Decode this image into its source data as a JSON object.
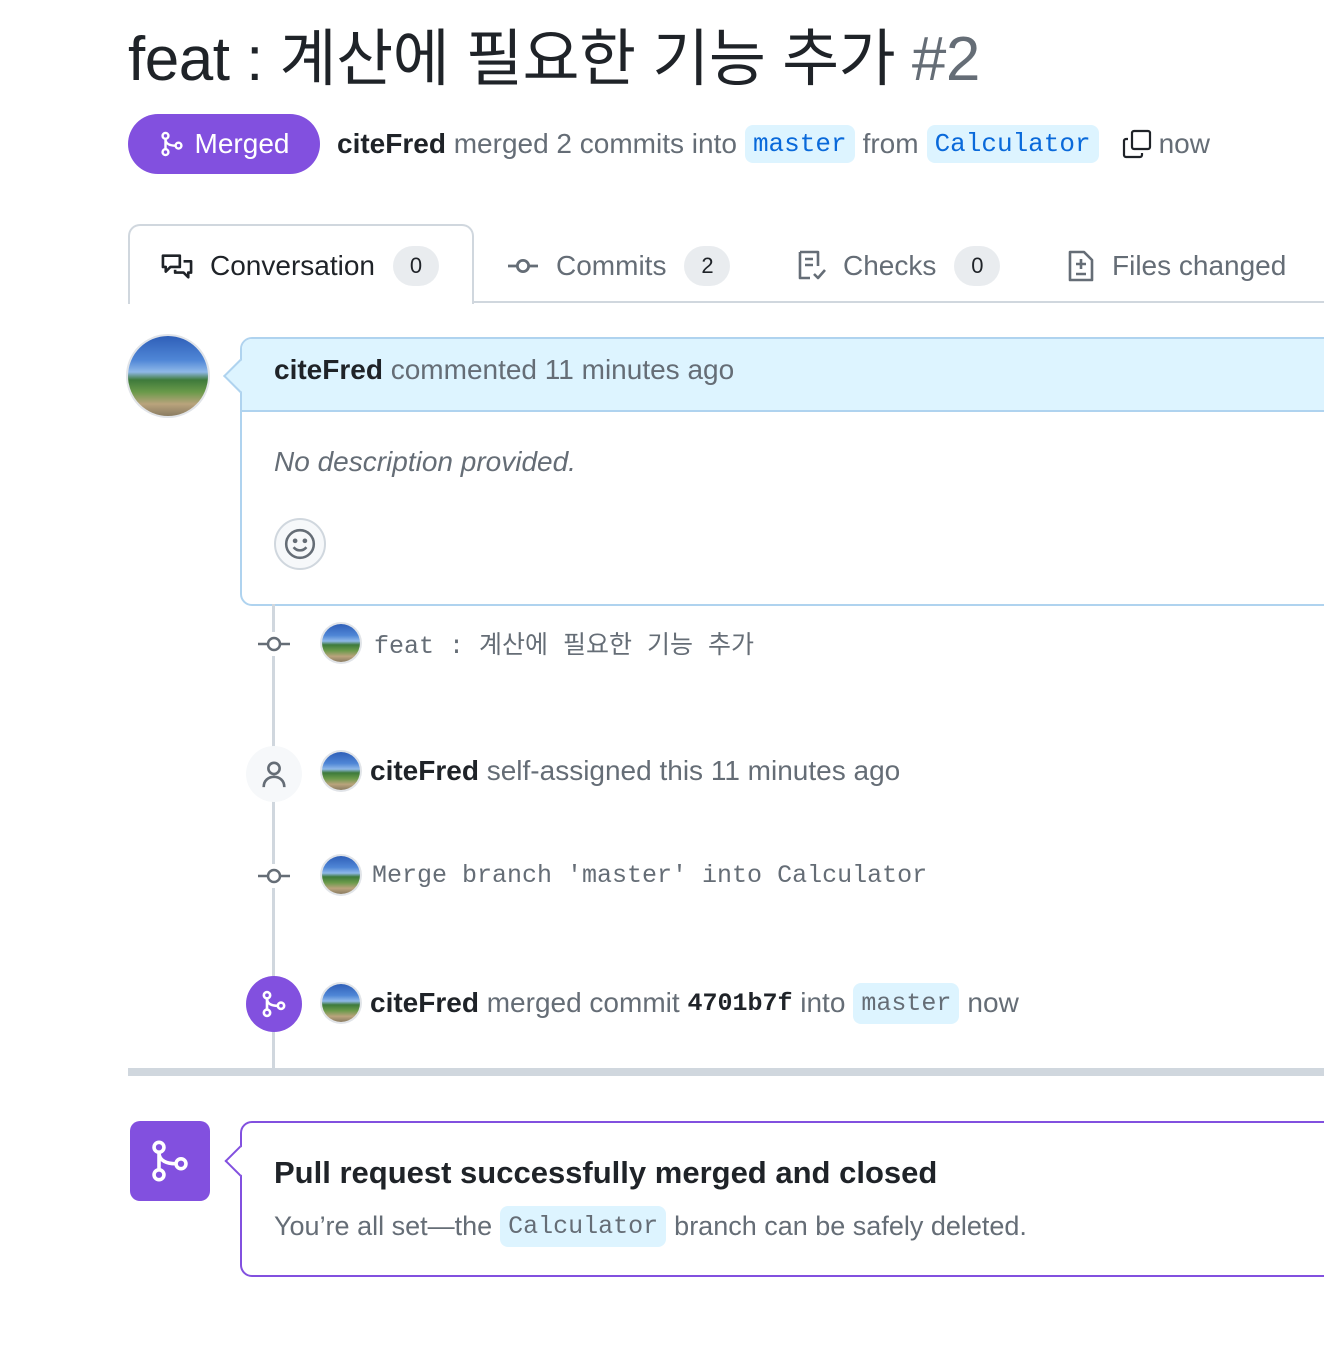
{
  "pr": {
    "title": "feat : 계산에 필요한 기능 추가",
    "number": "#2",
    "state_label": "Merged",
    "author": "citeFred",
    "merge_summary_mid": "merged 2 commits into",
    "base_branch": "master",
    "from_word": "from",
    "head_branch": "Calculator",
    "time": "now"
  },
  "tabs": [
    {
      "label": "Conversation",
      "count": "0",
      "icon": "comment-discussion-icon"
    },
    {
      "label": "Commits",
      "count": "2",
      "icon": "git-commit-icon"
    },
    {
      "label": "Checks",
      "count": "0",
      "icon": "checklist-icon"
    },
    {
      "label": "Files changed",
      "count": "",
      "icon": "file-diff-icon"
    }
  ],
  "comment": {
    "author": "citeFred",
    "action": "commented 11 minutes ago",
    "body": "No description provided."
  },
  "timeline": {
    "commit1": {
      "message": "feat : 계산에 필요한 기능 추가"
    },
    "assign": {
      "author": "citeFred",
      "text": "self-assigned this 11 minutes ago"
    },
    "commit2": {
      "message": "Merge branch 'master' into Calculator"
    },
    "merge": {
      "author": "citeFred",
      "text_pre": "merged commit",
      "sha": "4701b7f",
      "text_mid": "into",
      "branch": "master",
      "time": "now"
    }
  },
  "merge_status": {
    "title": "Pull request successfully merged and closed",
    "desc_pre": "You’re all set—the",
    "branch": "Calculator",
    "desc_post": "branch can be safely deleted."
  },
  "colors": {
    "merged_purple": "#8250df",
    "link_blue": "#0969da",
    "branch_bg": "#ddf4ff",
    "muted_text": "#656d76"
  }
}
